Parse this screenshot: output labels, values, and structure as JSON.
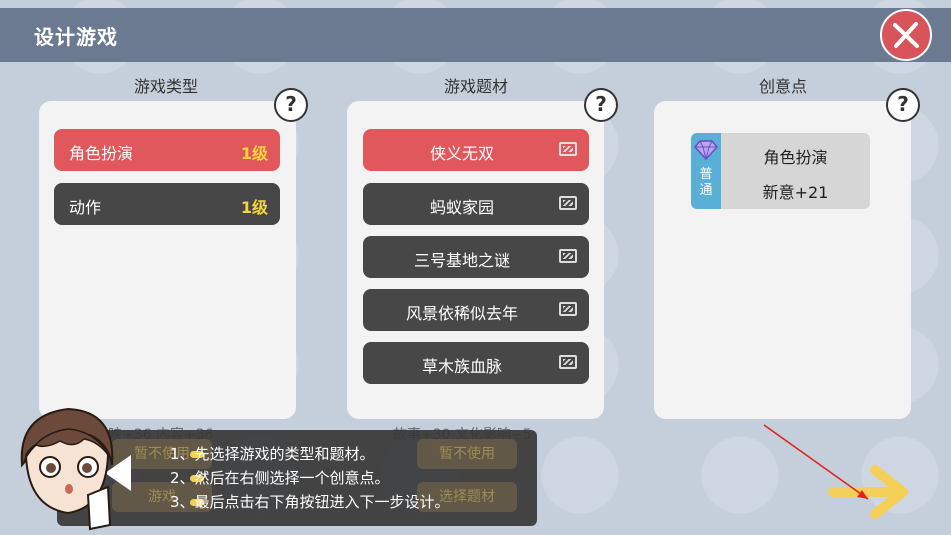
{
  "header": {
    "title": "设计游戏"
  },
  "columns": {
    "genre": {
      "title": "游戏类型",
      "help": "?",
      "items": [
        {
          "label": "角色扮演",
          "level": "1级"
        },
        {
          "label": "动作",
          "level": "1级"
        }
      ]
    },
    "theme": {
      "title": "游戏题材",
      "help": "?",
      "items": [
        {
          "label": "侠义无双"
        },
        {
          "label": "蚂蚁家园"
        },
        {
          "label": "三号基地之谜"
        },
        {
          "label": "风景依稀似去年"
        },
        {
          "label": "草木族血脉"
        }
      ]
    },
    "idea": {
      "title": "创意点",
      "help": "?",
      "card": {
        "rank": "普通",
        "name": "角色扮演",
        "bonus": "新意+21"
      }
    }
  },
  "below": {
    "genre_stats": "映+36  内容+36",
    "theme_stats": "故事+30  文化影响+5",
    "ghost_left": "暂不使用",
    "ghost_right": "暂不使用",
    "ghost_bottom_left": "游戏",
    "ghost_bottom_right": "选择题材"
  },
  "tutorial": {
    "tips": [
      "1、先选择游戏的类型和题材。",
      "2、然后在右侧选择一个创意点。",
      "3、最后点击右下角按钮进入下一步设计。"
    ]
  },
  "colors": {
    "header_bg": "#6b7a90",
    "selected": "#e0585b",
    "item_dark": "#474747",
    "level_yellow": "#f5d63a",
    "arrow_yellow": "#f5d058",
    "close_red": "#d9535b"
  },
  "icons": {
    "close": "close-x-icon",
    "help": "question-mark-icon",
    "tv": "tv-icon",
    "gem": "diamond-icon",
    "next": "arrow-right-icon",
    "sound": "speaker-icon"
  }
}
